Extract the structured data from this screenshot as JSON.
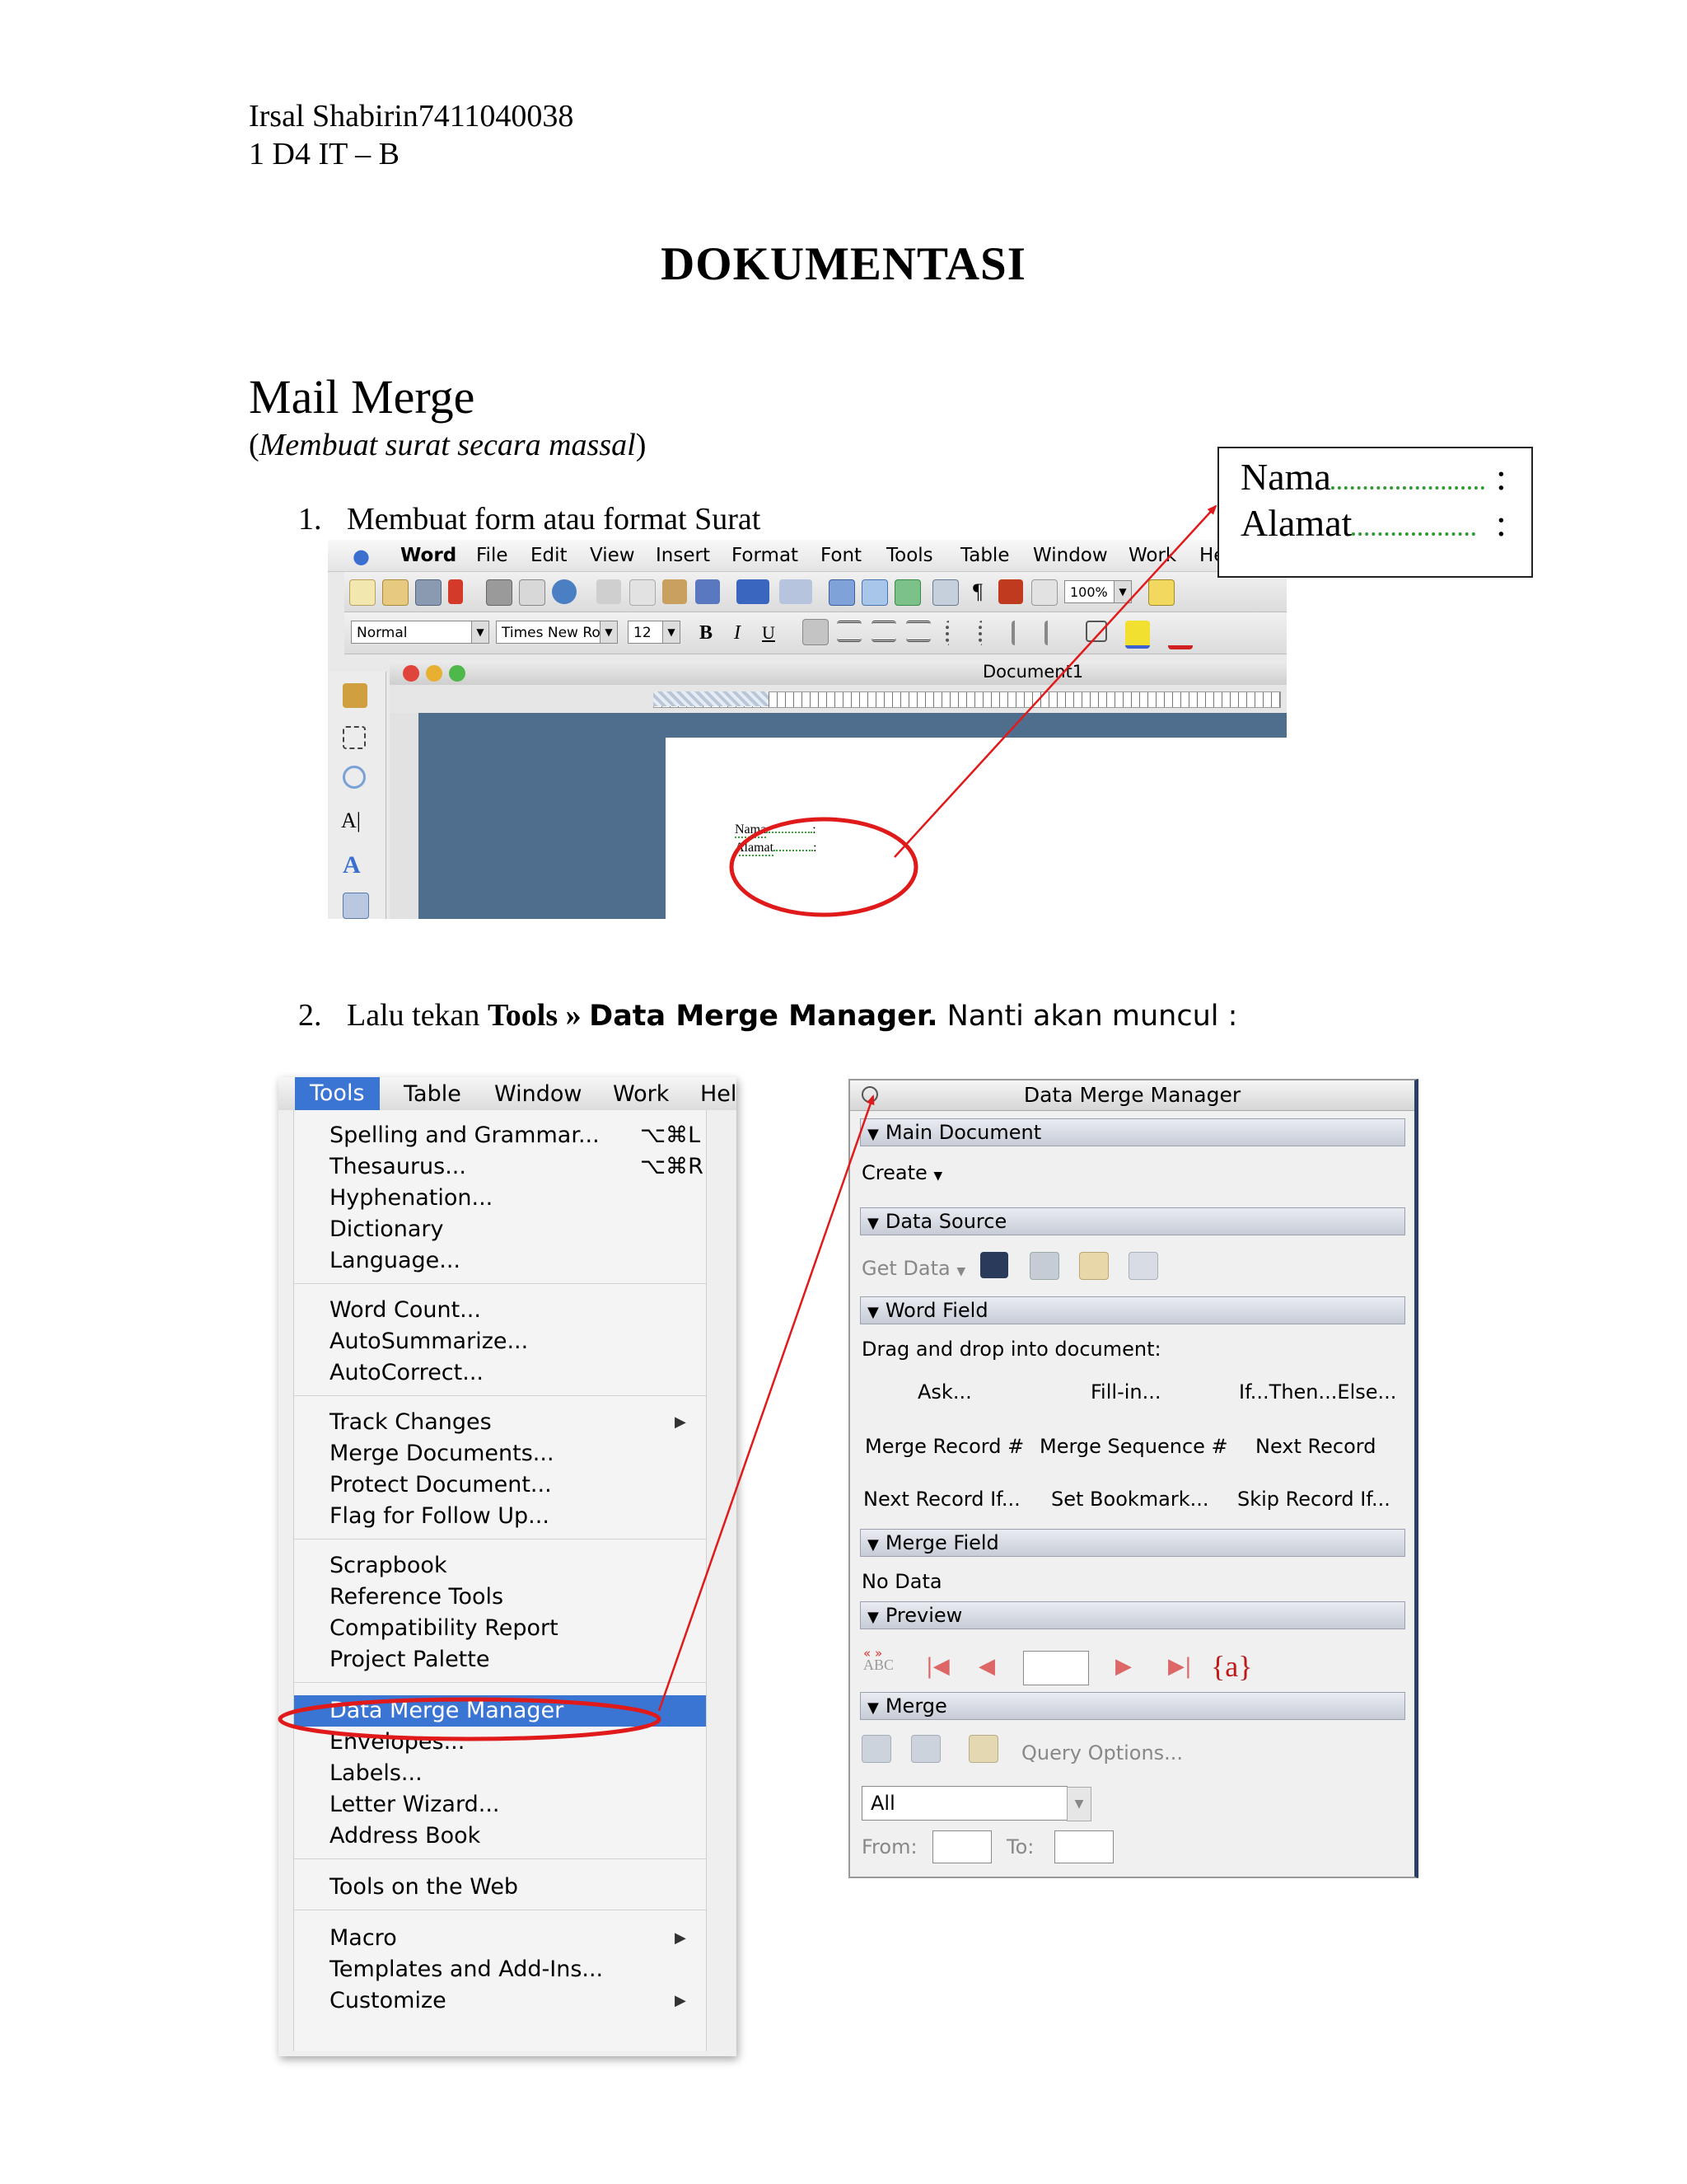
{
  "header": {
    "author_line": "Irsal Shabirin7411040038",
    "class_line": "1 D4 IT – B"
  },
  "title": "DOKUMENTASI",
  "section": {
    "title": "Mail Merge",
    "subtitle_open": "(",
    "subtitle_italic": "Membuat surat secara massal",
    "subtitle_close": ")"
  },
  "steps": [
    {
      "num": "1.",
      "text": "Membuat form atau format Surat"
    },
    {
      "num": "2.",
      "text_pre": "Lalu tekan ",
      "bold_serif": "Tools » ",
      "bold_sans": "Data Merge Manager.",
      "text_post": " Nanti akan muncul :"
    }
  ],
  "word_window": {
    "menu": [
      "Word",
      "File",
      "Edit",
      "View",
      "Insert",
      "Format",
      "Font",
      "Tools",
      "Table",
      "Window",
      "Work",
      "He"
    ],
    "style_combo": "Normal",
    "font_combo": "Times New Ro",
    "size_combo": "12",
    "zoom_combo": "100%",
    "bold": "B",
    "italic": "I",
    "underline": "U",
    "doc_title": "Document1",
    "field_nama": "Nama",
    "field_alamat": "Alamat",
    "colon": ":"
  },
  "zoom_box": {
    "line1": "Nama",
    "line2": "Alamat",
    "colon": ":"
  },
  "tools_menu": {
    "menubar": [
      "Tools",
      "Table",
      "Window",
      "Work",
      "Hel"
    ],
    "items": [
      {
        "label": "Spelling and Grammar...",
        "shortcut": "⌥⌘L"
      },
      {
        "label": "Thesaurus...",
        "shortcut": "⌥⌘R"
      },
      {
        "label": "Hyphenation..."
      },
      {
        "label": "Dictionary"
      },
      {
        "label": "Language..."
      },
      {
        "label": "Word Count..."
      },
      {
        "label": "AutoSummarize..."
      },
      {
        "label": "AutoCorrect..."
      },
      {
        "label": "Track Changes",
        "submenu": true
      },
      {
        "label": "Merge Documents..."
      },
      {
        "label": "Protect Document..."
      },
      {
        "label": "Flag for Follow Up..."
      },
      {
        "label": "Scrapbook"
      },
      {
        "label": "Reference Tools"
      },
      {
        "label": "Compatibility Report"
      },
      {
        "label": "Project Palette"
      },
      {
        "label": "Data Merge Manager",
        "highlight": true
      },
      {
        "label": "Envelopes..."
      },
      {
        "label": "Labels..."
      },
      {
        "label": "Letter Wizard..."
      },
      {
        "label": "Address Book"
      },
      {
        "label": "Tools on the Web"
      },
      {
        "label": "Macro",
        "submenu": true
      },
      {
        "label": "Templates and Add-Ins..."
      },
      {
        "label": "Customize",
        "submenu": true
      }
    ]
  },
  "dmm": {
    "title": "Data Merge Manager",
    "main_document": "Main Document",
    "create": "Create",
    "data_source": "Data Source",
    "get_data": "Get Data",
    "word_field": "Word Field",
    "drag_drop": "Drag and drop into document:",
    "fields": [
      [
        "Ask...",
        "Fill-in...",
        "If...Then...Else..."
      ],
      [
        "Merge Record #",
        "Merge Sequence #",
        "Next Record"
      ],
      [
        "Next Record If...",
        "Set Bookmark...",
        "Skip Record If..."
      ]
    ],
    "merge_field": "Merge Field",
    "no_data": "No Data",
    "preview": "Preview",
    "abc": "ABC",
    "field_code": "{a}",
    "merge": "Merge",
    "query_options": "Query Options...",
    "all": "All",
    "from": "From:",
    "to": "To:"
  }
}
